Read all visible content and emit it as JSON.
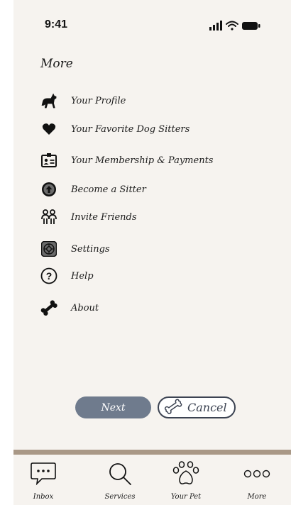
{
  "status_bar": {
    "time": "9:41"
  },
  "page": {
    "title": "More"
  },
  "menu": {
    "items": [
      {
        "label": "Your Profile",
        "icon": "dog-icon"
      },
      {
        "label": "Your Favorite Dog Sitters",
        "icon": "heart-icon"
      },
      {
        "label": "Your Membership & Payments",
        "icon": "id-badge-icon"
      },
      {
        "label": "Become a Sitter",
        "icon": "upload-circle-icon"
      },
      {
        "label": "Invite Friends",
        "icon": "people-icon"
      },
      {
        "label": "Settings",
        "icon": "settings-icon"
      },
      {
        "label": "Help",
        "icon": "help-icon"
      },
      {
        "label": "About",
        "icon": "bone-icon"
      }
    ]
  },
  "actions": {
    "next_label": "Next",
    "cancel_label": "Cancel"
  },
  "tabbar": {
    "tabs": [
      {
        "label": "Inbox",
        "icon": "chat-icon"
      },
      {
        "label": "Services",
        "icon": "search-icon"
      },
      {
        "label": "Your Pet",
        "icon": "paw-icon"
      },
      {
        "label": "More",
        "icon": "more-icon"
      }
    ]
  },
  "colors": {
    "background": "#f6f3ef",
    "next_button": "#6f7b8d",
    "divider": "#a99886",
    "text": "#1b1b1b"
  }
}
